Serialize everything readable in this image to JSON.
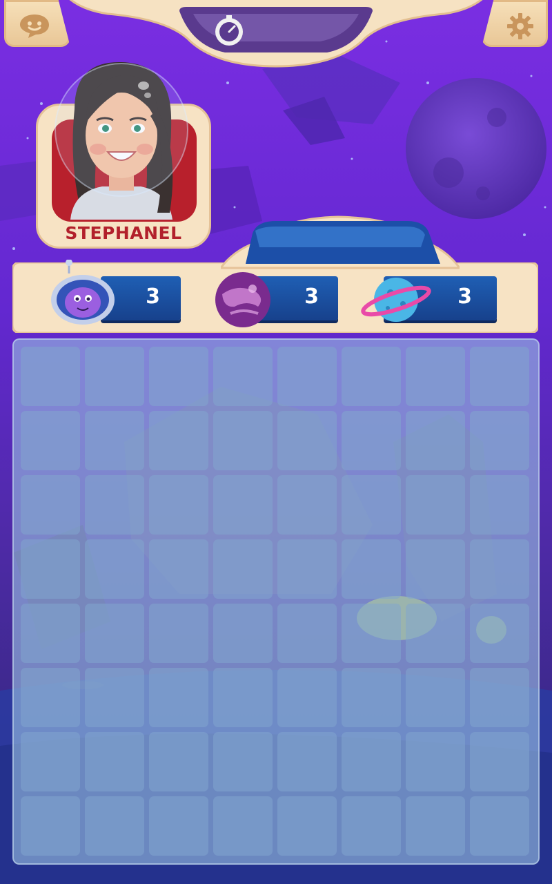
{
  "player": {
    "name": "STEPHANEL"
  },
  "top_bar": {
    "icon": "timer-icon"
  },
  "buttons": {
    "chat_icon": "chat-bubble-icon",
    "settings_icon": "gear-icon"
  },
  "counters": [
    {
      "icon": "robot-astronaut-icon",
      "value": "3"
    },
    {
      "icon": "purple-planet-icon",
      "value": "3"
    },
    {
      "icon": "ringed-planet-icon",
      "value": "3"
    }
  ],
  "board": {
    "rows": 8,
    "cols": 8
  },
  "colors": {
    "sky": "#6a2bd8",
    "panel": "#f7e3c4",
    "accent_red": "#b2202b",
    "counter_blue": "#1f5fb4"
  }
}
